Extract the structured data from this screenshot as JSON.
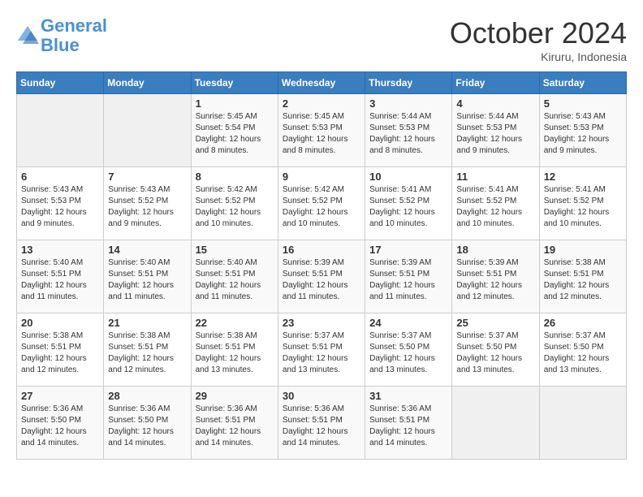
{
  "header": {
    "logo_line1": "General",
    "logo_line2": "Blue",
    "month": "October 2024",
    "location": "Kiruru, Indonesia"
  },
  "days_of_week": [
    "Sunday",
    "Monday",
    "Tuesday",
    "Wednesday",
    "Thursday",
    "Friday",
    "Saturday"
  ],
  "weeks": [
    [
      {
        "day": "",
        "sunrise": "",
        "sunset": "",
        "daylight": "",
        "empty": true
      },
      {
        "day": "",
        "sunrise": "",
        "sunset": "",
        "daylight": "",
        "empty": true
      },
      {
        "day": "1",
        "sunrise": "Sunrise: 5:45 AM",
        "sunset": "Sunset: 5:54 PM",
        "daylight": "Daylight: 12 hours and 8 minutes."
      },
      {
        "day": "2",
        "sunrise": "Sunrise: 5:45 AM",
        "sunset": "Sunset: 5:53 PM",
        "daylight": "Daylight: 12 hours and 8 minutes."
      },
      {
        "day": "3",
        "sunrise": "Sunrise: 5:44 AM",
        "sunset": "Sunset: 5:53 PM",
        "daylight": "Daylight: 12 hours and 8 minutes."
      },
      {
        "day": "4",
        "sunrise": "Sunrise: 5:44 AM",
        "sunset": "Sunset: 5:53 PM",
        "daylight": "Daylight: 12 hours and 9 minutes."
      },
      {
        "day": "5",
        "sunrise": "Sunrise: 5:43 AM",
        "sunset": "Sunset: 5:53 PM",
        "daylight": "Daylight: 12 hours and 9 minutes."
      }
    ],
    [
      {
        "day": "6",
        "sunrise": "Sunrise: 5:43 AM",
        "sunset": "Sunset: 5:53 PM",
        "daylight": "Daylight: 12 hours and 9 minutes."
      },
      {
        "day": "7",
        "sunrise": "Sunrise: 5:43 AM",
        "sunset": "Sunset: 5:52 PM",
        "daylight": "Daylight: 12 hours and 9 minutes."
      },
      {
        "day": "8",
        "sunrise": "Sunrise: 5:42 AM",
        "sunset": "Sunset: 5:52 PM",
        "daylight": "Daylight: 12 hours and 10 minutes."
      },
      {
        "day": "9",
        "sunrise": "Sunrise: 5:42 AM",
        "sunset": "Sunset: 5:52 PM",
        "daylight": "Daylight: 12 hours and 10 minutes."
      },
      {
        "day": "10",
        "sunrise": "Sunrise: 5:41 AM",
        "sunset": "Sunset: 5:52 PM",
        "daylight": "Daylight: 12 hours and 10 minutes."
      },
      {
        "day": "11",
        "sunrise": "Sunrise: 5:41 AM",
        "sunset": "Sunset: 5:52 PM",
        "daylight": "Daylight: 12 hours and 10 minutes."
      },
      {
        "day": "12",
        "sunrise": "Sunrise: 5:41 AM",
        "sunset": "Sunset: 5:52 PM",
        "daylight": "Daylight: 12 hours and 10 minutes."
      }
    ],
    [
      {
        "day": "13",
        "sunrise": "Sunrise: 5:40 AM",
        "sunset": "Sunset: 5:51 PM",
        "daylight": "Daylight: 12 hours and 11 minutes."
      },
      {
        "day": "14",
        "sunrise": "Sunrise: 5:40 AM",
        "sunset": "Sunset: 5:51 PM",
        "daylight": "Daylight: 12 hours and 11 minutes."
      },
      {
        "day": "15",
        "sunrise": "Sunrise: 5:40 AM",
        "sunset": "Sunset: 5:51 PM",
        "daylight": "Daylight: 12 hours and 11 minutes."
      },
      {
        "day": "16",
        "sunrise": "Sunrise: 5:39 AM",
        "sunset": "Sunset: 5:51 PM",
        "daylight": "Daylight: 12 hours and 11 minutes."
      },
      {
        "day": "17",
        "sunrise": "Sunrise: 5:39 AM",
        "sunset": "Sunset: 5:51 PM",
        "daylight": "Daylight: 12 hours and 11 minutes."
      },
      {
        "day": "18",
        "sunrise": "Sunrise: 5:39 AM",
        "sunset": "Sunset: 5:51 PM",
        "daylight": "Daylight: 12 hours and 12 minutes."
      },
      {
        "day": "19",
        "sunrise": "Sunrise: 5:38 AM",
        "sunset": "Sunset: 5:51 PM",
        "daylight": "Daylight: 12 hours and 12 minutes."
      }
    ],
    [
      {
        "day": "20",
        "sunrise": "Sunrise: 5:38 AM",
        "sunset": "Sunset: 5:51 PM",
        "daylight": "Daylight: 12 hours and 12 minutes."
      },
      {
        "day": "21",
        "sunrise": "Sunrise: 5:38 AM",
        "sunset": "Sunset: 5:51 PM",
        "daylight": "Daylight: 12 hours and 12 minutes."
      },
      {
        "day": "22",
        "sunrise": "Sunrise: 5:38 AM",
        "sunset": "Sunset: 5:51 PM",
        "daylight": "Daylight: 12 hours and 13 minutes."
      },
      {
        "day": "23",
        "sunrise": "Sunrise: 5:37 AM",
        "sunset": "Sunset: 5:51 PM",
        "daylight": "Daylight: 12 hours and 13 minutes."
      },
      {
        "day": "24",
        "sunrise": "Sunrise: 5:37 AM",
        "sunset": "Sunset: 5:50 PM",
        "daylight": "Daylight: 12 hours and 13 minutes."
      },
      {
        "day": "25",
        "sunrise": "Sunrise: 5:37 AM",
        "sunset": "Sunset: 5:50 PM",
        "daylight": "Daylight: 12 hours and 13 minutes."
      },
      {
        "day": "26",
        "sunrise": "Sunrise: 5:37 AM",
        "sunset": "Sunset: 5:50 PM",
        "daylight": "Daylight: 12 hours and 13 minutes."
      }
    ],
    [
      {
        "day": "27",
        "sunrise": "Sunrise: 5:36 AM",
        "sunset": "Sunset: 5:50 PM",
        "daylight": "Daylight: 12 hours and 14 minutes."
      },
      {
        "day": "28",
        "sunrise": "Sunrise: 5:36 AM",
        "sunset": "Sunset: 5:50 PM",
        "daylight": "Daylight: 12 hours and 14 minutes."
      },
      {
        "day": "29",
        "sunrise": "Sunrise: 5:36 AM",
        "sunset": "Sunset: 5:51 PM",
        "daylight": "Daylight: 12 hours and 14 minutes."
      },
      {
        "day": "30",
        "sunrise": "Sunrise: 5:36 AM",
        "sunset": "Sunset: 5:51 PM",
        "daylight": "Daylight: 12 hours and 14 minutes."
      },
      {
        "day": "31",
        "sunrise": "Sunrise: 5:36 AM",
        "sunset": "Sunset: 5:51 PM",
        "daylight": "Daylight: 12 hours and 14 minutes."
      },
      {
        "day": "",
        "sunrise": "",
        "sunset": "",
        "daylight": "",
        "empty": true
      },
      {
        "day": "",
        "sunrise": "",
        "sunset": "",
        "daylight": "",
        "empty": true
      }
    ]
  ]
}
